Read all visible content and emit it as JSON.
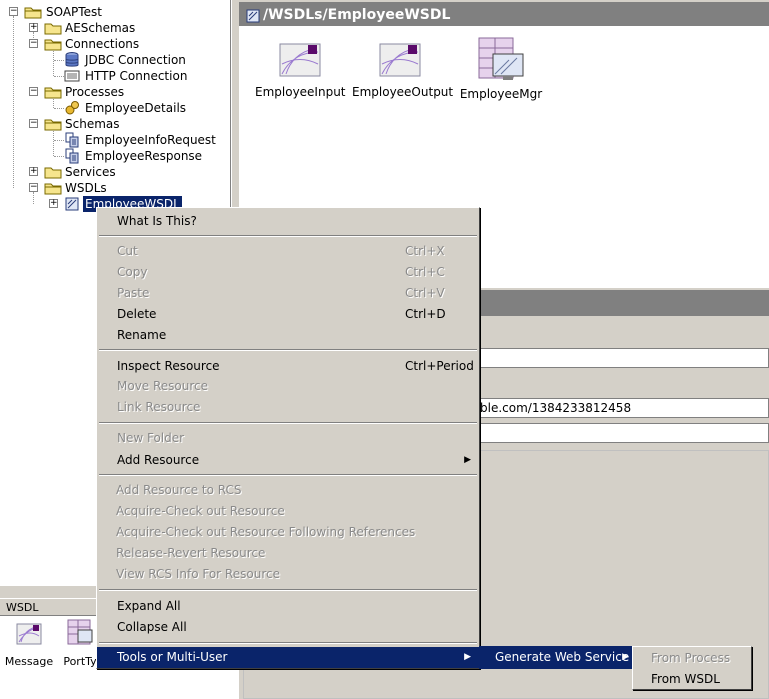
{
  "tree": {
    "root": "SOAPTest",
    "items": [
      {
        "label": "AESchemas"
      },
      {
        "label": "Connections"
      },
      {
        "label": "JDBC Connection"
      },
      {
        "label": "HTTP Connection"
      },
      {
        "label": "Processes"
      },
      {
        "label": "EmployeeDetails"
      },
      {
        "label": "Schemas"
      },
      {
        "label": "EmployeeInfoRequest"
      },
      {
        "label": "EmployeeResponse"
      },
      {
        "label": "Services"
      },
      {
        "label": "WSDLs"
      },
      {
        "label": "EmployeeWSDL"
      }
    ],
    "expand_glyph": "+",
    "collapse_glyph": "−"
  },
  "palette": {
    "tab_label": "WSDL",
    "items": [
      {
        "label": "Message"
      },
      {
        "label": "PortTy"
      }
    ]
  },
  "design": {
    "title": "/WSDLs/EmployeeWSDL",
    "resources": [
      {
        "label": "EmployeeInput",
        "icon": "wsdl-message-icon"
      },
      {
        "label": "EmployeeOutput",
        "icon": "wsdl-message-icon"
      },
      {
        "label": "EmployeeMgr",
        "icon": "port-type-icon"
      }
    ]
  },
  "config": {
    "namespace_value": "ble.com/1384233812458"
  },
  "context_menu": {
    "items": [
      {
        "label": "What Is This?",
        "shortcut": ""
      },
      {
        "label": "Cut",
        "shortcut": "Ctrl+X"
      },
      {
        "label": "Copy",
        "shortcut": "Ctrl+C"
      },
      {
        "label": "Paste",
        "shortcut": "Ctrl+V"
      },
      {
        "label": "Delete",
        "shortcut": "Ctrl+D"
      },
      {
        "label": "Rename",
        "shortcut": ""
      },
      {
        "label": "Inspect Resource",
        "shortcut": "Ctrl+Period"
      },
      {
        "label": "Move Resource",
        "shortcut": ""
      },
      {
        "label": "Link Resource",
        "shortcut": ""
      },
      {
        "label": "New Folder",
        "shortcut": ""
      },
      {
        "label": "Add Resource",
        "shortcut": ""
      },
      {
        "label": "Add Resource to RCS",
        "shortcut": ""
      },
      {
        "label": "Acquire-Check out Resource",
        "shortcut": ""
      },
      {
        "label": "Acquire-Check out Resource Following References",
        "shortcut": ""
      },
      {
        "label": "Release-Revert Resource",
        "shortcut": ""
      },
      {
        "label": "View RCS Info For Resource",
        "shortcut": ""
      },
      {
        "label": "Expand All",
        "shortcut": ""
      },
      {
        "label": "Collapse All",
        "shortcut": ""
      },
      {
        "label": "Tools or Multi-User",
        "shortcut": ""
      }
    ]
  },
  "submenu": {
    "generate_web_service": "Generate Web Service",
    "items": [
      {
        "label": "From Process"
      },
      {
        "label": "From WSDL"
      }
    ]
  },
  "colors": {
    "selection": "#0a246a",
    "panel": "#d4d0c8",
    "header": "#808080",
    "disabled_text": "#8a8a8a"
  }
}
